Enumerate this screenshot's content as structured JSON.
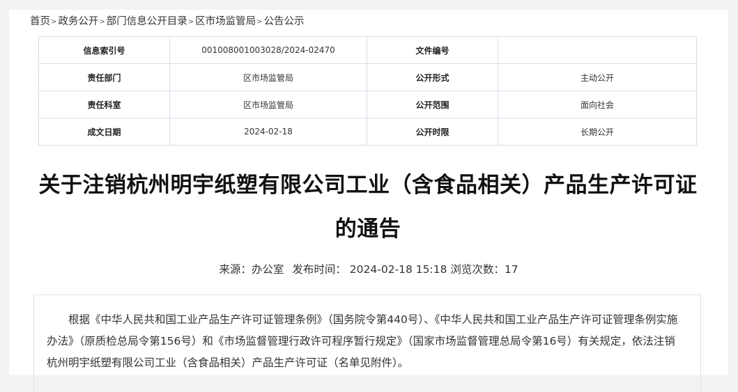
{
  "breadcrumb": [
    {
      "label": "首页"
    },
    {
      "label": "政务公开"
    },
    {
      "label": "部门信息公开目录"
    },
    {
      "label": "区市场监管局"
    },
    {
      "label": "公告公示"
    }
  ],
  "breadcrumb_separator": ">",
  "info_table": {
    "rows": [
      {
        "label1": "信息索引号",
        "value1": "001008001003028/2024-02470",
        "label2": "文件编号",
        "value2": ""
      },
      {
        "label1": "责任部门",
        "value1": "区市场监管局",
        "label2": "公开形式",
        "value2": "主动公开"
      },
      {
        "label1": "责任科室",
        "value1": "区市场监管局",
        "label2": "公开范围",
        "value2": "面向社会"
      },
      {
        "label1": "成文日期",
        "value1": "2024-02-18",
        "label2": "公开时限",
        "value2": "长期公开"
      }
    ]
  },
  "article": {
    "title_line1": "关于注销杭州明宇纸塑有限公司工业（含食品相关）产品生产许可证",
    "title_line2": "的通告",
    "meta": {
      "source_label": "来源：",
      "source": "办公室",
      "publish_label": "发布时间：",
      "publish_time": "2024-02-18 15:18",
      "views_label": "浏览次数：",
      "views": "17"
    },
    "body": "根据《中华人民共和国工业产品生产许可证管理条例》（国务院令第440号）、《中华人民共和国工业产品生产许可证管理条例实施办法》（原质检总局令第156号）和《市场监督管理行政许可程序暂行规定》（国家市场监督管理总局令第16号）有关规定，依法注销杭州明宇纸塑有限公司工业（含食品相关）产品生产许可证（名单见附件）。"
  }
}
